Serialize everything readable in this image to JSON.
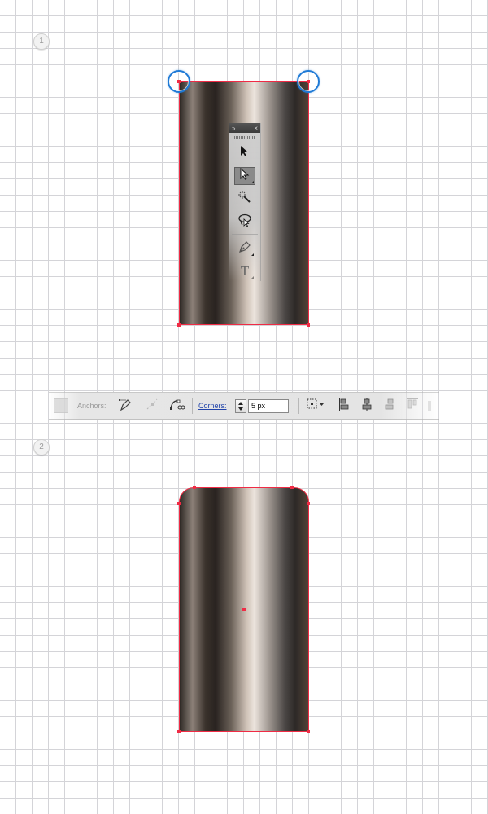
{
  "steps": [
    {
      "number": "1"
    },
    {
      "number": "2"
    }
  ],
  "tools_panel": {
    "title_left": "»",
    "title_close": "×",
    "tools": [
      "selection-tool",
      "direct-selection-tool",
      "magic-wand-tool",
      "lasso-tool",
      "pen-tool",
      "type-tool"
    ],
    "type_tool_glyph": "T"
  },
  "control_bar": {
    "anchors_label": "Anchors:",
    "corners_label": "Corners:",
    "corners_value": "5 px"
  },
  "colors": {
    "anchor_red": "#f02b45",
    "highlight_blue": "#1f7ad6",
    "corners_link": "#2244aa"
  }
}
